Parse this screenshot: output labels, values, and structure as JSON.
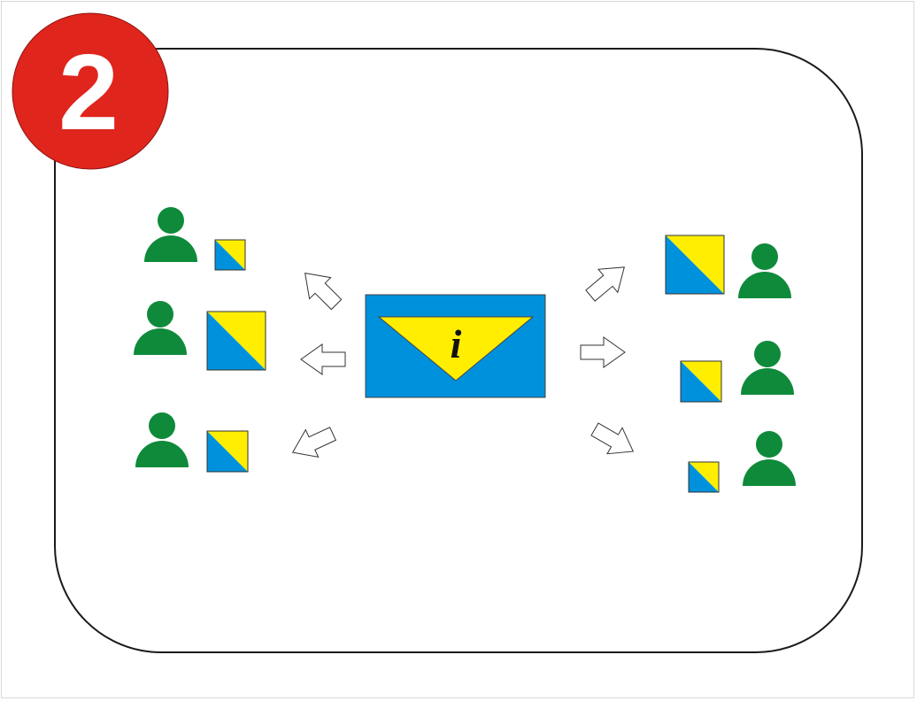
{
  "step": {
    "number": "2",
    "badge_color": "#e0251d",
    "text_color": "#ffffff"
  },
  "message": {
    "symbol": "i",
    "body_color": "#0091dc",
    "flap_color": "#ffee00"
  },
  "people": {
    "color": "#0e8a3a"
  },
  "tile": {
    "blue": "#0091dc",
    "yellow": "#ffee00"
  },
  "left_group": [
    {
      "person": "person-left-1",
      "tile": "small"
    },
    {
      "person": "person-left-2",
      "tile": "large"
    },
    {
      "person": "person-left-3",
      "tile": "medium"
    }
  ],
  "right_group": [
    {
      "person": "person-right-1",
      "tile": "large"
    },
    {
      "person": "person-right-2",
      "tile": "medium"
    },
    {
      "person": "person-right-3",
      "tile": "small"
    }
  ],
  "frame": {
    "stroke": "#1a1a1a"
  }
}
